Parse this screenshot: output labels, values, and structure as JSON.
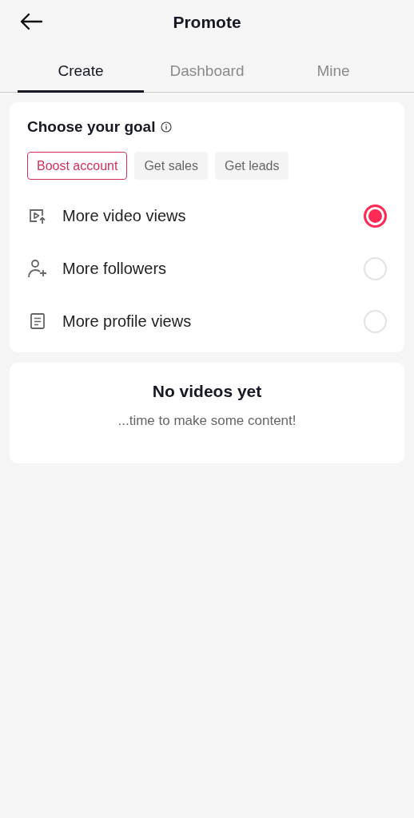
{
  "header": {
    "title": "Promote"
  },
  "tabs": [
    {
      "label": "Create",
      "selected": true
    },
    {
      "label": "Dashboard",
      "selected": false
    },
    {
      "label": "Mine",
      "selected": false
    }
  ],
  "goal_card": {
    "title": "Choose your goal",
    "chips": [
      {
        "label": "Boost account",
        "selected": true
      },
      {
        "label": "Get sales",
        "selected": false
      },
      {
        "label": "Get leads",
        "selected": false
      }
    ],
    "options": [
      {
        "kind": "video",
        "label": "More video views",
        "selected": true
      },
      {
        "kind": "followers",
        "label": "More followers",
        "selected": false
      },
      {
        "kind": "profile",
        "label": "More profile views",
        "selected": false
      }
    ]
  },
  "empty_card": {
    "title": "No videos yet",
    "message": "...time to make some content!"
  }
}
